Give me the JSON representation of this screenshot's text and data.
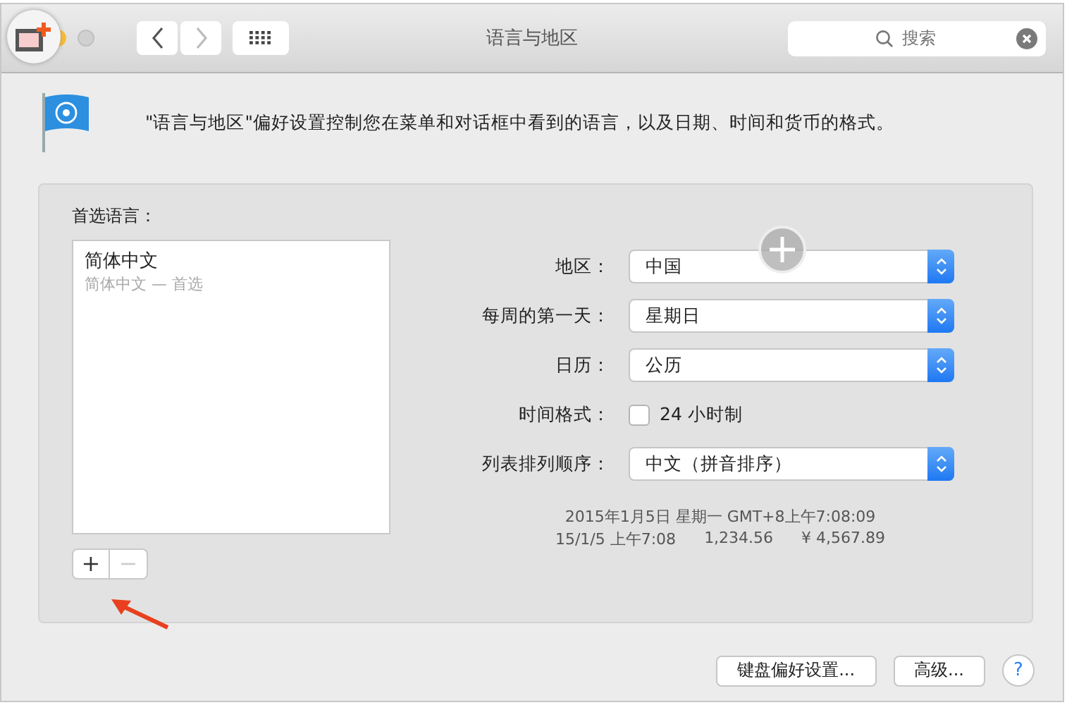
{
  "window": {
    "title": "语言与地区",
    "search": {
      "placeholder": "搜索"
    }
  },
  "description": "\"语言与地区\"偏好设置控制您在菜单和对话框中看到的语言，以及日期、时间和货币的格式。",
  "preferred_languages": {
    "label": "首选语言：",
    "items": [
      {
        "name": "简体中文",
        "detail": "简体中文 — 首选",
        "selected": false
      }
    ],
    "add": {
      "symbol": "+",
      "disabled": false
    },
    "remove": {
      "symbol": "−",
      "disabled": true
    }
  },
  "settings": [
    {
      "kind": "popup",
      "label": "地区：",
      "value": "中国"
    },
    {
      "kind": "popup",
      "label": "每周的第一天：",
      "value": "星期日"
    },
    {
      "kind": "popup",
      "label": "日历：",
      "value": "公历"
    },
    {
      "kind": "checkbox",
      "label": "时间格式：",
      "value": "24 小时制",
      "checked": false
    },
    {
      "kind": "popup",
      "label": "列表排列顺序：",
      "value": "中文（拼音排序）"
    }
  ],
  "sample": {
    "line_1": "2015年1月5日 星期一 GMT+8上午7:08:09",
    "date": "15/1/5 上午7:08",
    "number": "1,234.56",
    "currency": "¥ 4,567.89"
  },
  "buttons": [
    {
      "kind": "text",
      "label": "键盘偏好设置..."
    },
    {
      "kind": "text",
      "label": "高级..."
    },
    {
      "kind": "help",
      "label": "?"
    }
  ]
}
